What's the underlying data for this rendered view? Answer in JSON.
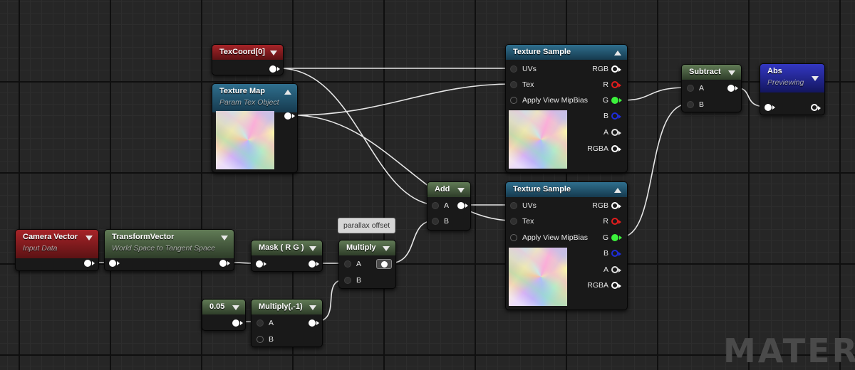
{
  "comment": {
    "text": "parallax offset"
  },
  "watermark": "MATER",
  "colors": {
    "wire": "#e6e6e6",
    "pin_red": "#e11d1d",
    "pin_green": "#3cf23c",
    "pin_blue": "#1e2dd8",
    "pin_white": "#ffffff",
    "header_red": "#a62428",
    "header_green": "#617b56",
    "header_teal": "#2f6f8e",
    "header_blue": "#3337c2"
  },
  "nodes": {
    "texcoord": {
      "title": "TexCoord[0]"
    },
    "texture_map": {
      "title": "Texture Map",
      "subtitle": "Param Tex Object"
    },
    "texture_sample_1": {
      "title": "Texture Sample",
      "inputs": [
        "UVs",
        "Tex",
        "Apply View MipBias"
      ],
      "outputs": [
        "RGB",
        "R",
        "G",
        "B",
        "A",
        "RGBA"
      ]
    },
    "texture_sample_2": {
      "title": "Texture Sample",
      "inputs": [
        "UVs",
        "Tex",
        "Apply View MipBias"
      ],
      "outputs": [
        "RGB",
        "R",
        "G",
        "B",
        "A",
        "RGBA"
      ]
    },
    "subtract": {
      "title": "Subtract",
      "inputs": [
        "A",
        "B"
      ]
    },
    "abs": {
      "title": "Abs",
      "subtitle": "Previewing"
    },
    "add": {
      "title": "Add",
      "inputs": [
        "A",
        "B"
      ]
    },
    "camera_vector": {
      "title": "Camera Vector",
      "subtitle": "Input Data"
    },
    "transform_vector": {
      "title": "TransformVector",
      "subtitle": "World Space to Tangent Space"
    },
    "mask": {
      "title": "Mask ( R G )"
    },
    "multiply": {
      "title": "Multiply",
      "inputs": [
        "A",
        "B"
      ]
    },
    "constant": {
      "title": "0.05"
    },
    "multiply_neg": {
      "title": "Multiply(,-1)",
      "inputs": [
        "A",
        "B"
      ]
    }
  }
}
